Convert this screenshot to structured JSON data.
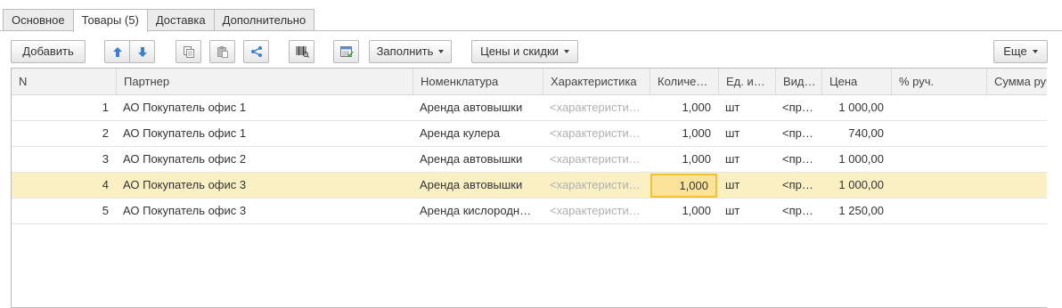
{
  "tabs": [
    {
      "label": "Основное"
    },
    {
      "label": "Товары (5)"
    },
    {
      "label": "Доставка"
    },
    {
      "label": "Дополнительно"
    }
  ],
  "toolbar": {
    "add_label": "Добавить",
    "fill_label": "Заполнить",
    "prices_label": "Цены и скидки",
    "more_label": "Еще",
    "icons": [
      "arrow-up-icon",
      "arrow-down-icon",
      "copy-icon",
      "paste-icon",
      "share-icon",
      "barcode-icon",
      "table-select-icon"
    ]
  },
  "table": {
    "columns": [
      "N",
      "Партнер",
      "Номенклатура",
      "Характеристика",
      "Количе…",
      "Ед. и…",
      "Вид…",
      "Цена",
      "% руч.",
      "Сумма руч"
    ],
    "rows": [
      {
        "n": "1",
        "partner": "АО Покупатель офис 1",
        "item": "Аренда автовышки",
        "char": "<характеристи…",
        "qty": "1,000",
        "unit": "шт",
        "kind": "<пр…",
        "price": "1 000,00"
      },
      {
        "n": "2",
        "partner": "АО Покупатель офис 1",
        "item": "Аренда кулера",
        "char": "<характеристи…",
        "qty": "1,000",
        "unit": "шт",
        "kind": "<пр…",
        "price": "740,00"
      },
      {
        "n": "3",
        "partner": "АО Покупатель офис 2",
        "item": "Аренда автовышки",
        "char": "<характеристи…",
        "qty": "1,000",
        "unit": "шт",
        "kind": "<пр…",
        "price": "1 000,00"
      },
      {
        "n": "4",
        "partner": "АО Покупатель офис 3",
        "item": "Аренда автовышки",
        "char": "<характеристи…",
        "qty": "1,000",
        "unit": "шт",
        "kind": "<пр…",
        "price": "1 000,00"
      },
      {
        "n": "5",
        "partner": "АО Покупатель офис 3",
        "item": "Аренда кислородн…",
        "char": "<характеристи…",
        "qty": "1,000",
        "unit": "шт",
        "kind": "<пр…",
        "price": "1 250,00"
      }
    ],
    "selected_row": 4
  },
  "colors": {
    "selected_row": "#fbf0c4",
    "focus_cell": "#fbe49a",
    "focus_border": "#f0c13b",
    "arrow_blue": "#3a7fd5"
  }
}
